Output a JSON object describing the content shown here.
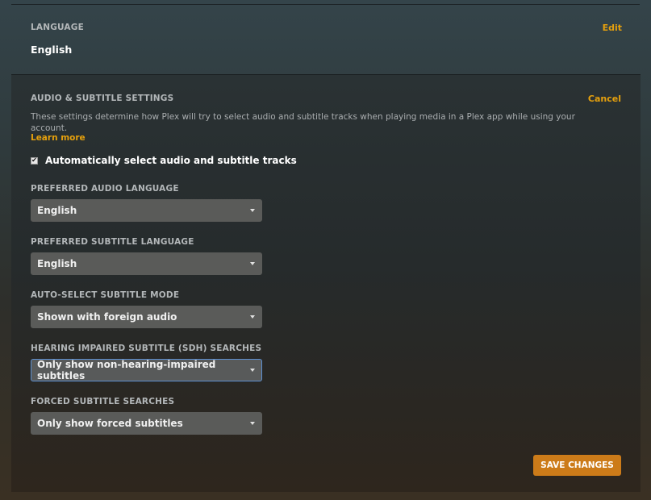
{
  "language": {
    "title": "LANGUAGE",
    "edit_label": "Edit",
    "value": "English"
  },
  "audio_subtitle": {
    "title": "AUDIO & SUBTITLE SETTINGS",
    "cancel_label": "Cancel",
    "description": "These settings determine how Plex will try to select audio and subtitle tracks when playing media in a Plex app while using your account.",
    "learn_more": "Learn more",
    "auto_select": {
      "label": "Automatically select audio and subtitle tracks",
      "checked": true,
      "check_glyph": "✔"
    },
    "fields": [
      {
        "label": "PREFERRED AUDIO LANGUAGE",
        "value": "English"
      },
      {
        "label": "PREFERRED SUBTITLE LANGUAGE",
        "value": "English"
      },
      {
        "label": "AUTO-SELECT SUBTITLE MODE",
        "value": "Shown with foreign audio"
      },
      {
        "label": "HEARING IMPAIRED SUBTITLE (SDH) SEARCHES",
        "value": "Only show non-hearing-impaired subtitles"
      },
      {
        "label": "FORCED SUBTITLE SEARCHES",
        "value": "Only show forced subtitles"
      }
    ],
    "save_label": "SAVE CHANGES"
  },
  "colors": {
    "accent": "#e5a00d",
    "save_button": "#cc7b19",
    "focus_border": "#5d8fcf"
  }
}
